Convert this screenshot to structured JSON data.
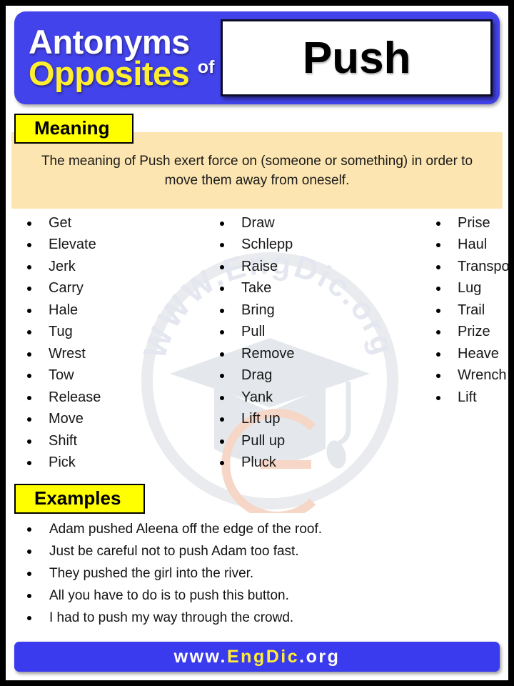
{
  "header": {
    "line1": "Antonyms",
    "line2": "Opposites",
    "connector": "of",
    "word": "Push",
    "bg_color": "#4343EC",
    "line1_color": "#FFFFFF",
    "line2_color": "#FFEF2E"
  },
  "meaning": {
    "tag": "Meaning",
    "text": "The meaning of Push exert force on (someone or something) in order to move them away from oneself.",
    "band_color": "#FCE5B0",
    "tag_color": "#FFFF00"
  },
  "antonym_columns": [
    {
      "id": "column-1",
      "words": [
        "Get",
        "Elevate",
        "Jerk",
        "Carry",
        "Hale",
        "Tug",
        "Wrest",
        "Tow",
        "Release",
        "Move",
        "Shift",
        "Pick"
      ]
    },
    {
      "id": "column-2",
      "words": [
        "Draw",
        "Schlepp",
        "Raise",
        "Take",
        "Bring",
        "Pull",
        "Remove",
        "Drag",
        "Yank",
        "Lift up",
        "Pull up",
        "Pluck"
      ]
    },
    {
      "id": "column-3",
      "words": [
        "Prise",
        "Haul",
        "Transport",
        "Lug",
        "Trail",
        "Prize",
        "Heave",
        "Wrench",
        "Lift"
      ]
    }
  ],
  "examples": {
    "tag": "Examples",
    "items": [
      "Adam pushed Aleena off the edge of the roof.",
      "Just be careful not to push Adam too fast.",
      "They pushed the girl into the river.",
      "All you have to do is to push this button.",
      "I had to push my way through the crowd."
    ]
  },
  "footer": {
    "prefix": "www.",
    "brand": "EngDic",
    "suffix": ".org",
    "bg_color": "#3A3AEE",
    "brand_color": "#FFEE33"
  },
  "watermark": {
    "text": "WWW.EngDic.org",
    "icon": "graduation-cap"
  }
}
